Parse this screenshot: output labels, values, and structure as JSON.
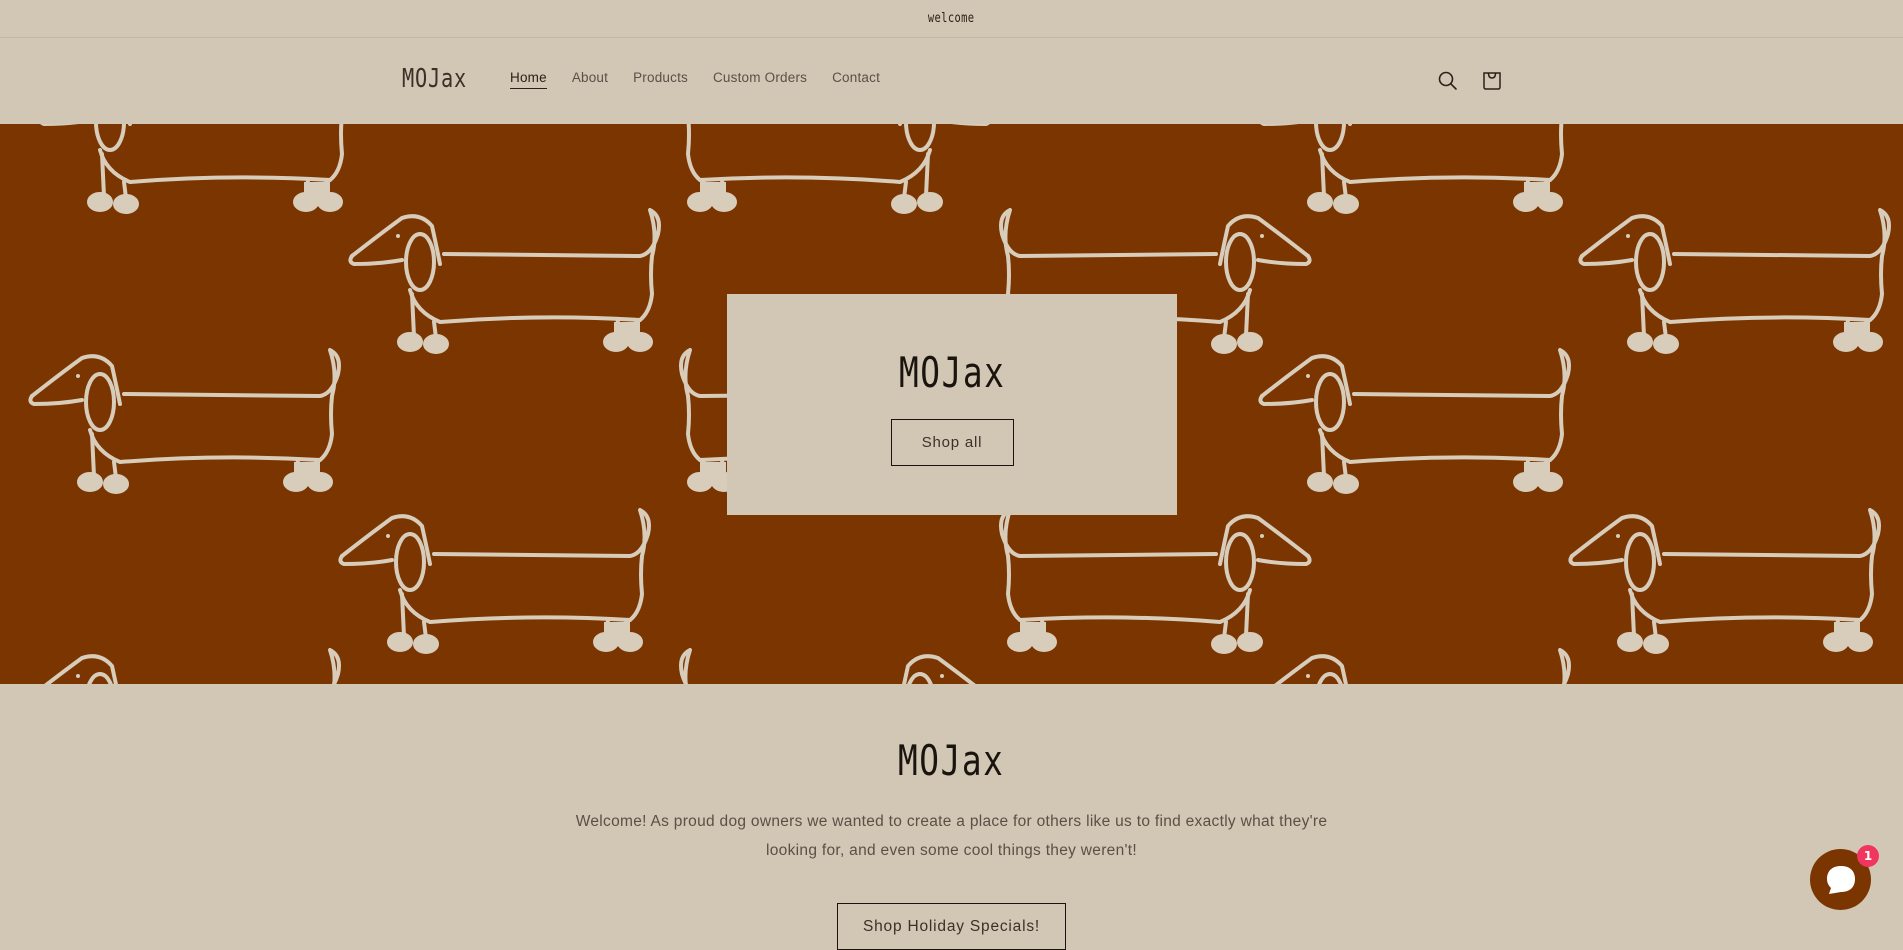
{
  "announcement": {
    "text": "welcome"
  },
  "header": {
    "logo": "MOJax",
    "nav": [
      {
        "label": "Home",
        "active": true
      },
      {
        "label": "About",
        "active": false
      },
      {
        "label": "Products",
        "active": false
      },
      {
        "label": "Custom Orders",
        "active": false
      },
      {
        "label": "Contact",
        "active": false
      }
    ],
    "icons": {
      "search": "search-icon",
      "cart": "cart-icon"
    }
  },
  "hero": {
    "title": "MOJax",
    "button_label": "Shop all",
    "background_color": "#7a3500",
    "pattern": "dachshund-line-drawing",
    "pattern_color": "#d8ccbb"
  },
  "welcome": {
    "title": "MOJax",
    "text": "Welcome! As proud dog owners we wanted to create a place for others like us to find exactly what they're looking for, and even some cool things they weren't!",
    "button_label": "Shop Holiday Specials!"
  },
  "chat": {
    "icon": "chat-bubble-icon",
    "badge_count": "1",
    "color": "#7a3500",
    "badge_color": "#f0365e"
  },
  "colors": {
    "page_background": "#d2c6b5",
    "text_dark": "#1a140e",
    "text_muted": "#5a5046"
  }
}
